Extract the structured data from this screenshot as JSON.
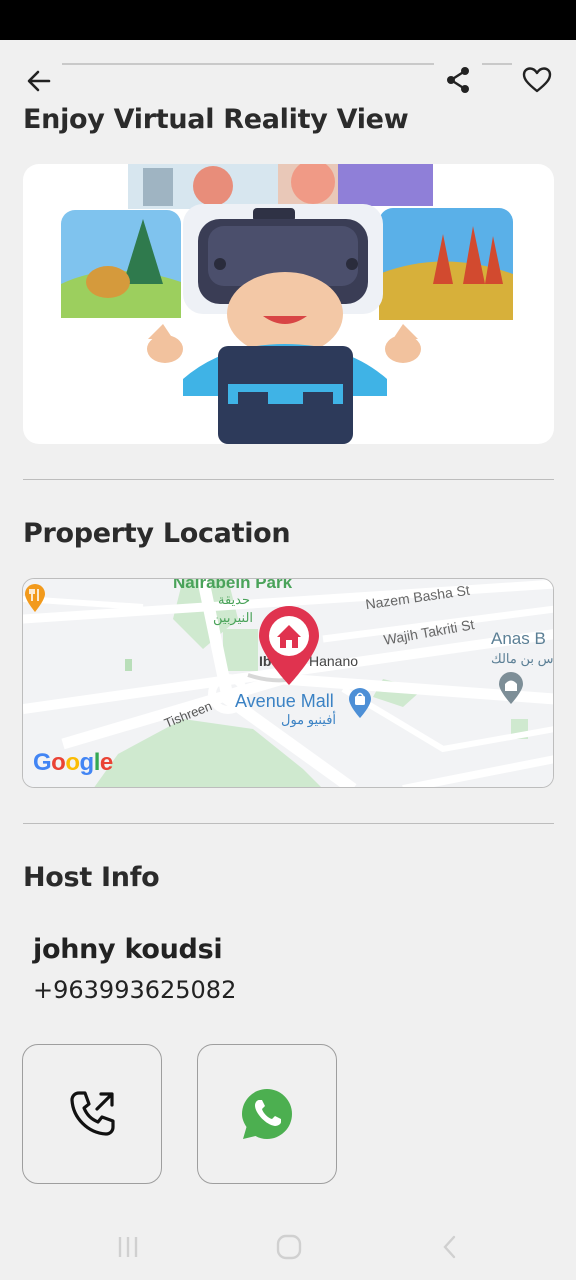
{
  "header": {
    "icons": [
      "back-arrow-icon",
      "share-icon",
      "heart-icon"
    ]
  },
  "vr_section": {
    "title": "Enjoy Virtual Reality View"
  },
  "location_section": {
    "title": "Property Location",
    "map": {
      "labels": {
        "park_en": "Nairabein Park",
        "park_ar_1": "حديقة",
        "park_ar_2": "النيربين",
        "street_1": "Nazem Basha St",
        "street_2": "Wajih Takriti St",
        "place_right": "Anas B",
        "place_right_ar": "س بن مالك",
        "street_3": "Hanano",
        "street_3_prefix": "Ib",
        "mall_en": "Avenue Mall",
        "mall_ar": "أفينيو مول",
        "street_4": "Tishreen",
        "google": "Google"
      }
    }
  },
  "host_section": {
    "title": "Host Info",
    "name": "johny koudsi",
    "phone": "+963993625082"
  },
  "actions": {
    "call_icon": "phone-call-icon",
    "whatsapp_icon": "whatsapp-icon"
  },
  "colors": {
    "background": "#f0f0f0",
    "accent_pin": "#e0334f",
    "whatsapp": "#4caf50",
    "map_green": "#cfe9cf",
    "map_text_blue": "#3b82c4"
  }
}
